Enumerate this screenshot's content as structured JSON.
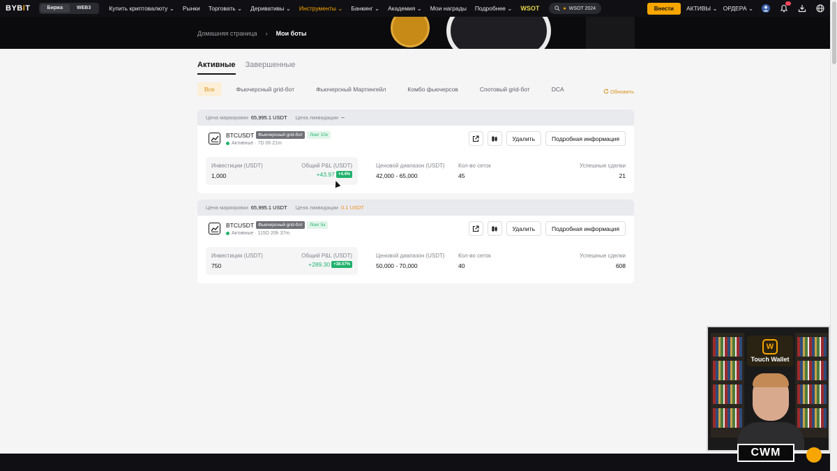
{
  "nav": {
    "logo_main": "BYB",
    "logo_accent": "I",
    "logo_end": "T",
    "switcher": [
      "Биржа",
      "WEB3"
    ],
    "items": [
      {
        "label": "Купить криптовалюту",
        "caret": true
      },
      {
        "label": "Рынки",
        "caret": false
      },
      {
        "label": "Торговать",
        "caret": true
      },
      {
        "label": "Деривативы",
        "caret": true
      },
      {
        "label": "Инструменты",
        "caret": true,
        "highlight": true
      },
      {
        "label": "Банкинг",
        "caret": true
      },
      {
        "label": "Академия",
        "caret": true
      },
      {
        "label": "Мои награды",
        "caret": false
      },
      {
        "label": "Подробнее",
        "caret": true
      }
    ],
    "wsot": "WSOT",
    "search_pill": "WSOT 2024",
    "deposit": "Внести",
    "assets": "АКТИВЫ",
    "orders": "ОРДЕРА"
  },
  "breadcrumb": {
    "home": "Домашняя страница",
    "current": "Мои боты"
  },
  "tabs": [
    "Активные",
    "Завершенные"
  ],
  "filters": [
    "Все",
    "Фьючерсный grid-бот",
    "Фьючерсный Мартингейл",
    "Комбо фьючерсов",
    "Спотовый grid-бот",
    "DCA"
  ],
  "refresh": "Обновить",
  "labels": {
    "mark_price": "Цена маркировки",
    "liq_price": "Цена ликвидации",
    "investment": "Инвестиции (USDT)",
    "pnl": "Общий P&L (USDT)",
    "range": "Ценовой диапазон (USDT)",
    "grids": "Кол-во сеток",
    "trades": "Успешные сделки",
    "delete": "Удалить",
    "details": "Подробная информация"
  },
  "bots": [
    {
      "mark_price": "65,995.1 USDT",
      "liq_price": "--",
      "liq_warn": false,
      "symbol": "BTCUSDT",
      "type": "Фьючерсный grid-бот",
      "leverage": "Лонг 10x",
      "status": "Активные · 7D 0h 21m",
      "investment": "1,000",
      "pnl": "+43.97",
      "pnl_pct": "+4.4%",
      "range": "42,000 - 65,000",
      "grids": "45",
      "trades": "21"
    },
    {
      "mark_price": "65,995.1 USDT",
      "liq_price": "0.1 USDT",
      "liq_warn": true,
      "symbol": "BTCUSDT",
      "type": "Фьючерсный grid-бот",
      "leverage": "Лонг 5x",
      "status": "Активные · 115D 20h 37m",
      "investment": "750",
      "pnl": "+289.30",
      "pnl_pct": "+38.57%",
      "range": "50,000 - 70,000",
      "grids": "40",
      "trades": "608"
    }
  ],
  "overlay": {
    "cam_logo": "Touch Wallet",
    "cam_logo_glyph": "W",
    "cwm": "CWM"
  },
  "colors": {
    "accent": "#f7a600",
    "positive": "#20b26c",
    "warning": "#f08c1a"
  }
}
